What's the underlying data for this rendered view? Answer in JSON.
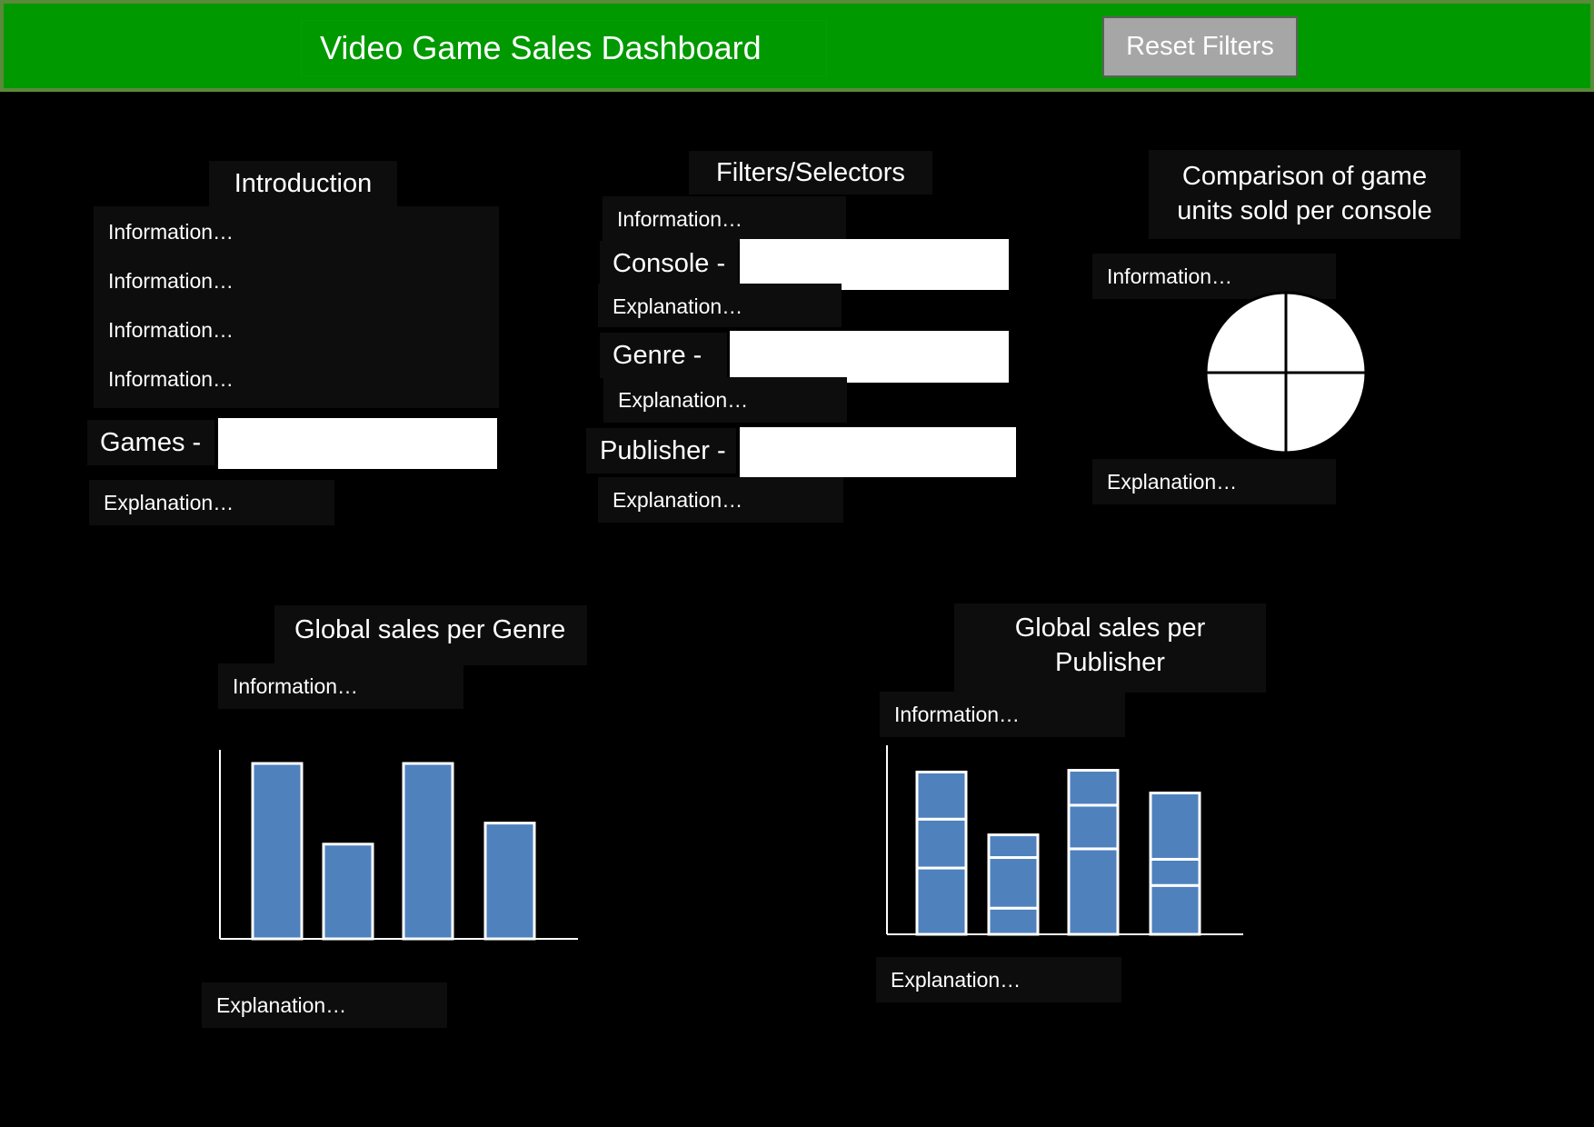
{
  "header": {
    "title": "Video Game Sales Dashboard",
    "reset_label": "Reset Filters",
    "bg_color": "#009900",
    "button_color": "#a6a6a6"
  },
  "introduction": {
    "title": "Introduction",
    "info": [
      "Information…",
      "Information…",
      "Information…",
      "Information…"
    ],
    "games_label": "Games -",
    "games_value": "",
    "explanation": "Explanation…"
  },
  "filters": {
    "title": "Filters/Selectors",
    "info": "Information…",
    "console_label": "Console -",
    "console_value": "",
    "console_explanation": "Explanation…",
    "genre_label": "Genre -",
    "genre_value": "",
    "genre_explanation": "Explanation…",
    "publisher_label": "Publisher -",
    "publisher_value": "",
    "publisher_explanation": "Explanation…"
  },
  "console_comparison": {
    "title_line1": "Comparison of game",
    "title_line2": "units sold per console",
    "info": "Information…",
    "explanation": "Explanation…"
  },
  "genre_sales": {
    "title": "Global sales per Genre",
    "info": "Information…",
    "explanation": "Explanation…"
  },
  "publisher_sales": {
    "title_line1": "Global sales per",
    "title_line2": "Publisher",
    "info": "Information…",
    "explanation": "Explanation…"
  },
  "chart_data": [
    {
      "type": "pie",
      "title": "",
      "slices": [
        25,
        25,
        25,
        25
      ],
      "colors": [
        "#ffffff"
      ]
    },
    {
      "type": "bar",
      "title": "",
      "categories": [
        "",
        "",
        "",
        ""
      ],
      "values": [
        100,
        54,
        100,
        66
      ],
      "ylim": [
        0,
        100
      ],
      "color": "#4f81bd"
    },
    {
      "type": "bar",
      "title": "",
      "stacked": true,
      "categories": [
        "",
        "",
        "",
        ""
      ],
      "series": [
        {
          "values": [
            38,
            15,
            49,
            28
          ]
        },
        {
          "values": [
            28,
            29,
            25,
            15
          ]
        },
        {
          "values": [
            27,
            13,
            20,
            38
          ]
        }
      ],
      "ylim": [
        0,
        100
      ],
      "color": "#4f81bd"
    }
  ]
}
